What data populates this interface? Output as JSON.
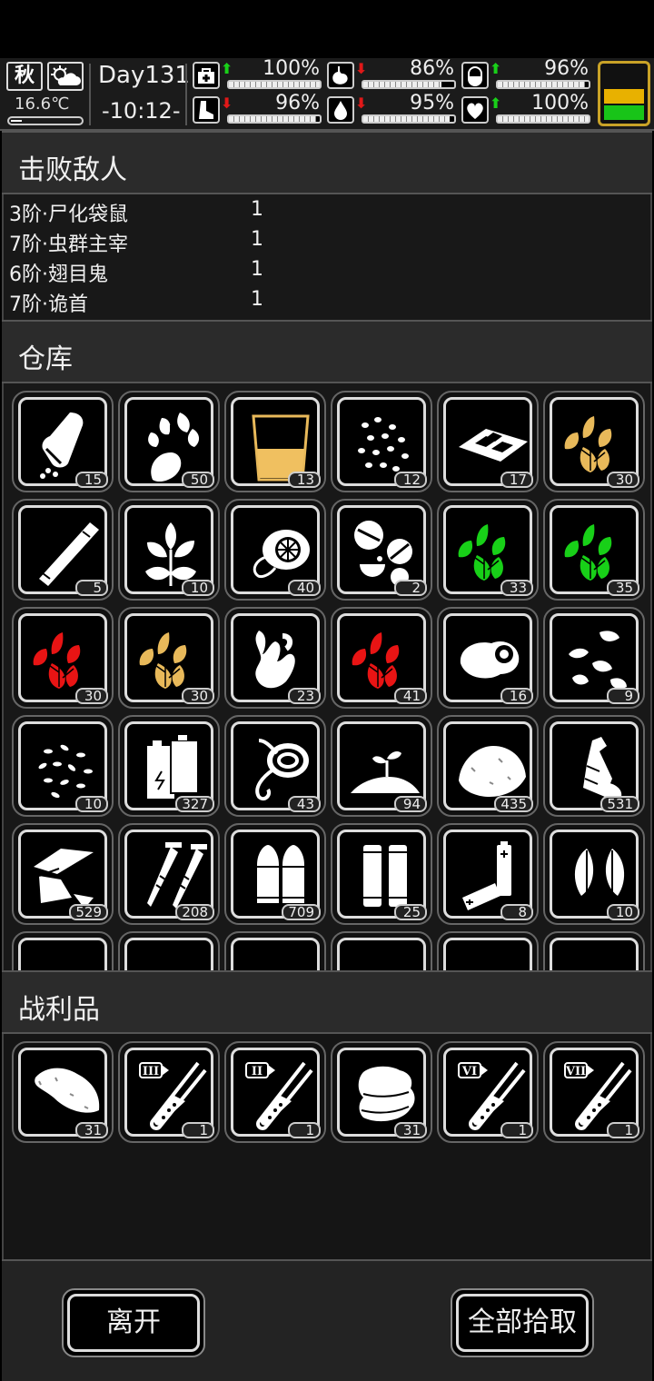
{
  "status": {
    "season": "秋",
    "weather_icon": "partly-cloudy-icon",
    "temperature": "16.6℃",
    "day": "Day131",
    "time": "-10:12-",
    "stats": [
      {
        "icon": "medkit-icon",
        "trend": "up",
        "value": "100%",
        "level": 1.0
      },
      {
        "icon": "stomach-icon",
        "trend": "down",
        "value": "86%",
        "level": 0.86
      },
      {
        "icon": "pill-icon",
        "trend": "up",
        "value": "96%",
        "level": 0.96
      },
      {
        "icon": "boot-icon",
        "trend": "down",
        "value": "96%",
        "level": 0.96
      },
      {
        "icon": "water-drop-icon",
        "trend": "down",
        "value": "95%",
        "level": 0.95
      },
      {
        "icon": "heart-icon",
        "trend": "up",
        "value": "100%",
        "level": 1.0
      }
    ],
    "colors": {
      "up": "#19d019",
      "down": "#e01818",
      "battery_top": "#e8b100",
      "battery_bottom": "#18c418"
    }
  },
  "defeated": {
    "title": "击败敌人",
    "enemies": [
      {
        "name": "3阶·尸化袋鼠",
        "count": "1"
      },
      {
        "name": "7阶·虫群主宰",
        "count": "1"
      },
      {
        "name": "6阶·翅目鬼",
        "count": "1"
      },
      {
        "name": "7阶·诡首",
        "count": "1"
      }
    ]
  },
  "warehouse": {
    "title": "仓库",
    "items": [
      {
        "icon": "pill-bottle-icon",
        "count": "15"
      },
      {
        "icon": "vegetable-icon",
        "count": "50"
      },
      {
        "icon": "juice-glass-icon",
        "count": "13"
      },
      {
        "icon": "beans-icon",
        "count": "12"
      },
      {
        "icon": "biscuits-icon",
        "count": "17"
      },
      {
        "icon": "yellow-herb-icon",
        "count": "30"
      },
      {
        "icon": "cigar-icon",
        "count": "5"
      },
      {
        "icon": "mint-leaf-icon",
        "count": "10"
      },
      {
        "icon": "filter-icon",
        "count": "40"
      },
      {
        "icon": "tablets-icon",
        "count": "2"
      },
      {
        "icon": "green-herb-icon",
        "count": "33"
      },
      {
        "icon": "green-herb-icon",
        "count": "35"
      },
      {
        "icon": "red-herb-icon",
        "count": "30"
      },
      {
        "icon": "yellow-herb-icon",
        "count": "30"
      },
      {
        "icon": "ginger-root-icon",
        "count": "23"
      },
      {
        "icon": "red-herb-icon",
        "count": "41"
      },
      {
        "icon": "meat-icon",
        "count": "16"
      },
      {
        "icon": "seeds-icon",
        "count": "9"
      },
      {
        "icon": "rice-grains-icon",
        "count": "10"
      },
      {
        "icon": "battery-pack-icon",
        "count": "327"
      },
      {
        "icon": "rope-icon",
        "count": "43"
      },
      {
        "icon": "soil-sprout-icon",
        "count": "94"
      },
      {
        "icon": "powder-pile-icon",
        "count": "435"
      },
      {
        "icon": "plastic-bottle-icon",
        "count": "531"
      },
      {
        "icon": "scrap-pieces-icon",
        "count": "529"
      },
      {
        "icon": "screws-icon",
        "count": "208"
      },
      {
        "icon": "bullets-icon",
        "count": "709"
      },
      {
        "icon": "shells-icon",
        "count": "25"
      },
      {
        "icon": "batteries-icon",
        "count": "8"
      },
      {
        "icon": "leaves-icon",
        "count": "10"
      }
    ]
  },
  "loot": {
    "title": "战利品",
    "items": [
      {
        "icon": "sweet-potato-icon",
        "count": "31"
      },
      {
        "icon": "test-tube-icon",
        "tier": "III",
        "count": "1"
      },
      {
        "icon": "test-tube-icon",
        "tier": "II",
        "count": "1"
      },
      {
        "icon": "cloth-icon",
        "count": "31"
      },
      {
        "icon": "test-tube-icon",
        "tier": "VI",
        "count": "1"
      },
      {
        "icon": "test-tube-icon",
        "tier": "VII",
        "count": "1"
      }
    ]
  },
  "footer": {
    "leave_label": "离开",
    "take_all_label": "全部拾取"
  }
}
